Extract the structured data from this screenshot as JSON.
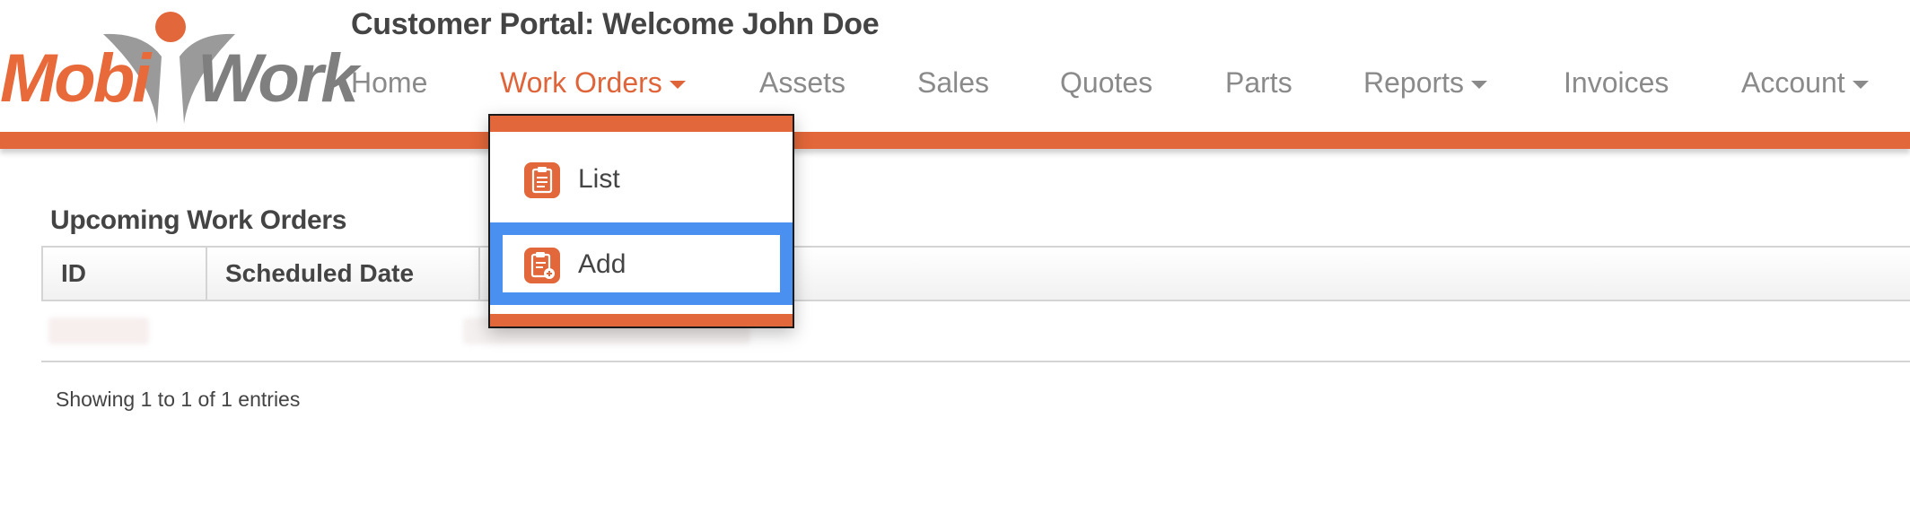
{
  "header": {
    "logo": {
      "part1": "Mobi",
      "part2": "Work"
    },
    "title": "Customer Portal: Welcome John Doe"
  },
  "nav": {
    "items": [
      {
        "label": "Home"
      },
      {
        "label": "Work Orders",
        "active": true,
        "dropdown": true
      },
      {
        "label": "Assets"
      },
      {
        "label": "Sales"
      },
      {
        "label": "Quotes"
      },
      {
        "label": "Parts"
      },
      {
        "label": "Reports",
        "dropdown": true
      },
      {
        "label": "Invoices"
      },
      {
        "label": "Account",
        "dropdown": true
      }
    ]
  },
  "dropdown": {
    "items": [
      {
        "label": "List",
        "icon": "clipboard-list-icon"
      },
      {
        "label": "Add",
        "icon": "clipboard-add-icon",
        "highlighted": true
      }
    ]
  },
  "main": {
    "section_title": "Upcoming Work Orders",
    "table": {
      "columns": [
        "ID",
        "Scheduled Date"
      ]
    },
    "entries_info": "Showing 1 to 1 of 1 entries"
  },
  "colors": {
    "brand_orange": "#e2673a",
    "highlight_blue": "#4a90f0",
    "nav_text": "#8a8a8a"
  }
}
